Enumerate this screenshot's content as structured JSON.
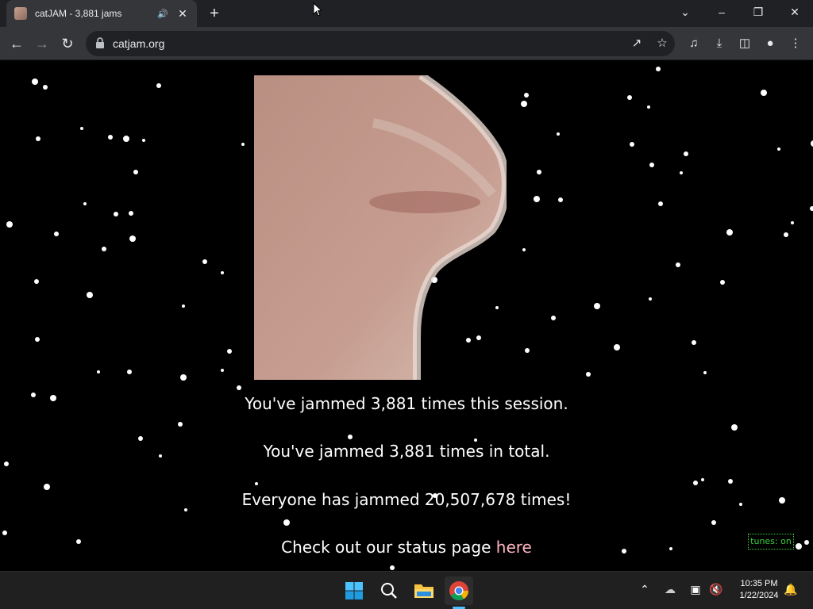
{
  "browser": {
    "tab_title": "catJAM - 3,881 jams",
    "url": "catjam.org"
  },
  "page": {
    "session_line": "You've jammed 3,881 times this session.",
    "total_line": "You've jammed 3,881 times in total.",
    "everyone_line": "Everyone has jammed 20,507,678 times!",
    "status_prefix": "Check out our status page ",
    "status_link": "here",
    "tunes_label": "tunes: on"
  },
  "taskbar": {
    "time": "10:35 PM",
    "date": "1/22/2024"
  },
  "colors": {
    "link": "#ffb6c1",
    "tunes": "#3bd13b",
    "chrome_dark": "#202124",
    "chrome_mid": "#35363a"
  },
  "icons": {
    "tab": [
      "cat-favicon-icon",
      "audio-playing-icon",
      "close-icon",
      "new-tab-icon"
    ],
    "window": [
      "chevron-down-icon",
      "minimize-icon",
      "restore-icon",
      "close-window-icon"
    ],
    "toolbar": [
      "back-icon",
      "forward-icon",
      "reload-icon",
      "lock-icon",
      "share-icon",
      "bookmark-star-icon",
      "media-control-icon",
      "download-icon",
      "side-panel-icon",
      "profile-icon",
      "menu-icon"
    ],
    "taskbar": [
      "windows-start-icon",
      "search-icon",
      "file-explorer-icon",
      "chrome-icon",
      "tray-chevron-icon",
      "cloud-off-icon",
      "network-icon",
      "volume-muted-icon",
      "notification-bell-icon"
    ]
  }
}
